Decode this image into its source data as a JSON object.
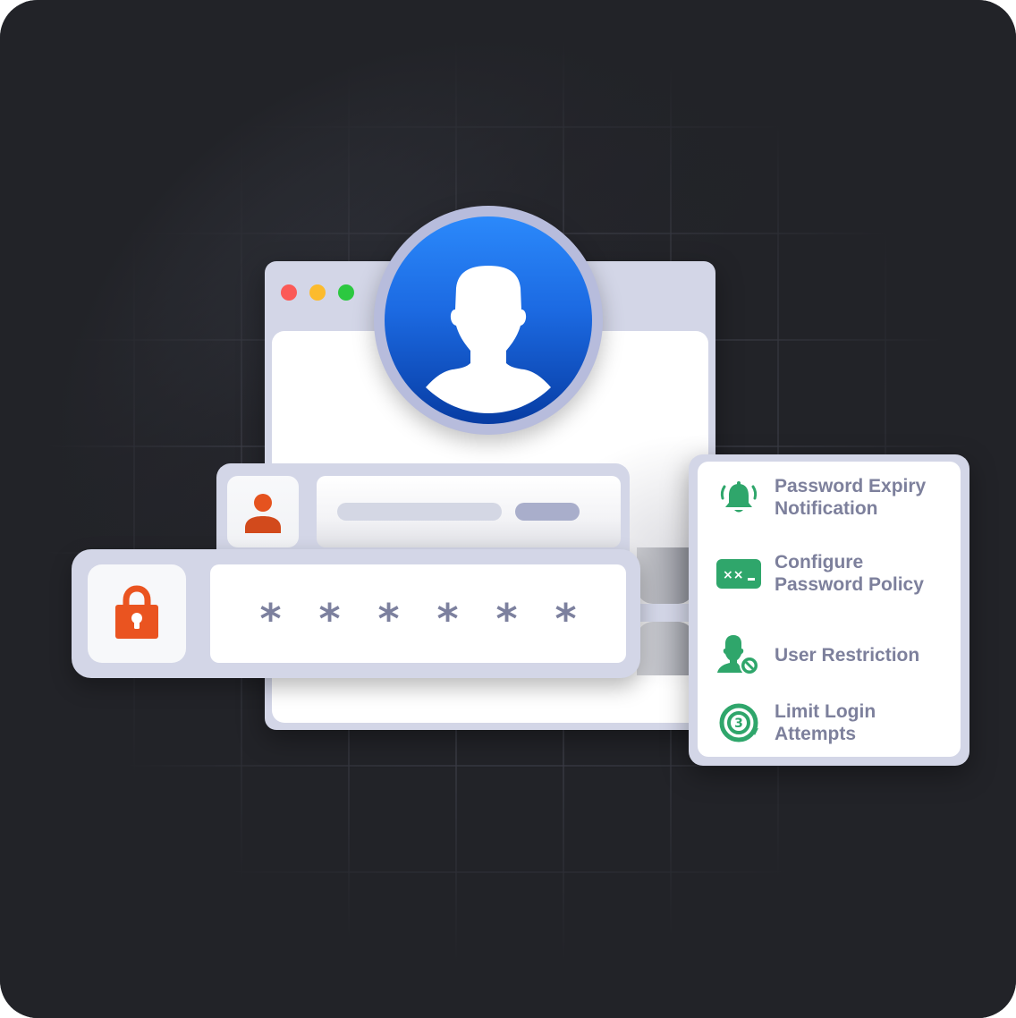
{
  "illustration": {
    "title": "Login security illustration",
    "colors": {
      "background_dark": "#222328",
      "frame": "#d3d6e7",
      "avatar_blue": "#1c6ae2",
      "accent_orange": "#e8531f",
      "feature_green": "#2fa66b",
      "text_muted": "#7d809c"
    }
  },
  "browser_window": {
    "controls": [
      {
        "name": "close",
        "color": "#fb5a57"
      },
      {
        "name": "minimize",
        "color": "#fcbb2d"
      },
      {
        "name": "maximize",
        "color": "#2cc840"
      }
    ],
    "avatar_icon": "user-silhouette-icon"
  },
  "login_form": {
    "username_field": {
      "icon": "user-icon",
      "value_placeholder": "",
      "button_placeholder": ""
    },
    "password_field": {
      "icon": "lock-icon",
      "masked_chars": [
        "*",
        "*",
        "*",
        "*",
        "*",
        "*"
      ]
    }
  },
  "features": [
    {
      "icon": "bell-icon",
      "line1": "Password Expiry",
      "line2": "Notification"
    },
    {
      "icon": "password-terminal-icon",
      "icon_text": "xx_",
      "line1": "Configure",
      "line2": "Password Policy"
    },
    {
      "icon": "user-blocked-icon",
      "line1": "User Restriction",
      "line2": ""
    },
    {
      "icon": "retry-three-icon",
      "icon_text": "3",
      "line1": "Limit Login",
      "line2": "Attempts"
    }
  ]
}
